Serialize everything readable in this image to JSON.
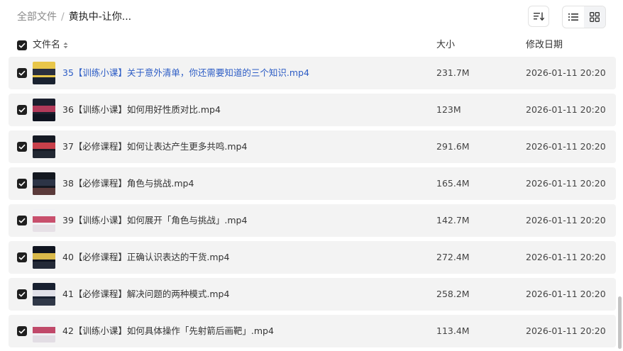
{
  "breadcrumb": {
    "root": "全部文件",
    "separator": "/",
    "current": "黄执中-让你..."
  },
  "toolbar": {
    "sort_icon": "sort-lines-icon",
    "list_icon": "list-view-icon",
    "grid_icon": "grid-view-icon",
    "active_view": "list"
  },
  "columns": {
    "name": "文件名",
    "size": "大小",
    "modified": "修改日期"
  },
  "colors": {
    "checkbox": "#1f1f1f",
    "row_bg": "#f3f3f3",
    "link": "#2c5cc5"
  },
  "files": [
    {
      "name": "35【训练小课】关于意外清单，你还需要知道的三个知识.mp4",
      "size": "231.7M",
      "modified": "2026-01-11 20:20",
      "highlighted": true,
      "checked": true
    },
    {
      "name": "36【训练小课】如何用好性质对比.mp4",
      "size": "123M",
      "modified": "2026-01-11 20:20",
      "highlighted": false,
      "checked": true
    },
    {
      "name": "37【必修课程】如何让表达产生更多共鸣.mp4",
      "size": "291.6M",
      "modified": "2026-01-11 20:20",
      "highlighted": false,
      "checked": true
    },
    {
      "name": "38【必修课程】角色与挑战.mp4",
      "size": "165.4M",
      "modified": "2026-01-11 20:20",
      "highlighted": false,
      "checked": true
    },
    {
      "name": "39【训练小课】如何展开「角色与挑战」.mp4",
      "size": "142.7M",
      "modified": "2026-01-11 20:20",
      "highlighted": false,
      "checked": true
    },
    {
      "name": "40【必修课程】正确认识表达的干货.mp4",
      "size": "272.4M",
      "modified": "2026-01-11 20:20",
      "highlighted": false,
      "checked": true
    },
    {
      "name": "41【必修课程】解决问题的两种模式.mp4",
      "size": "258.2M",
      "modified": "2026-01-11 20:20",
      "highlighted": false,
      "checked": true
    },
    {
      "name": "42【训练小课】如何具体操作「先射箭后画靶」.mp4",
      "size": "113.4M",
      "modified": "2026-01-11 20:20",
      "highlighted": false,
      "checked": true
    }
  ]
}
